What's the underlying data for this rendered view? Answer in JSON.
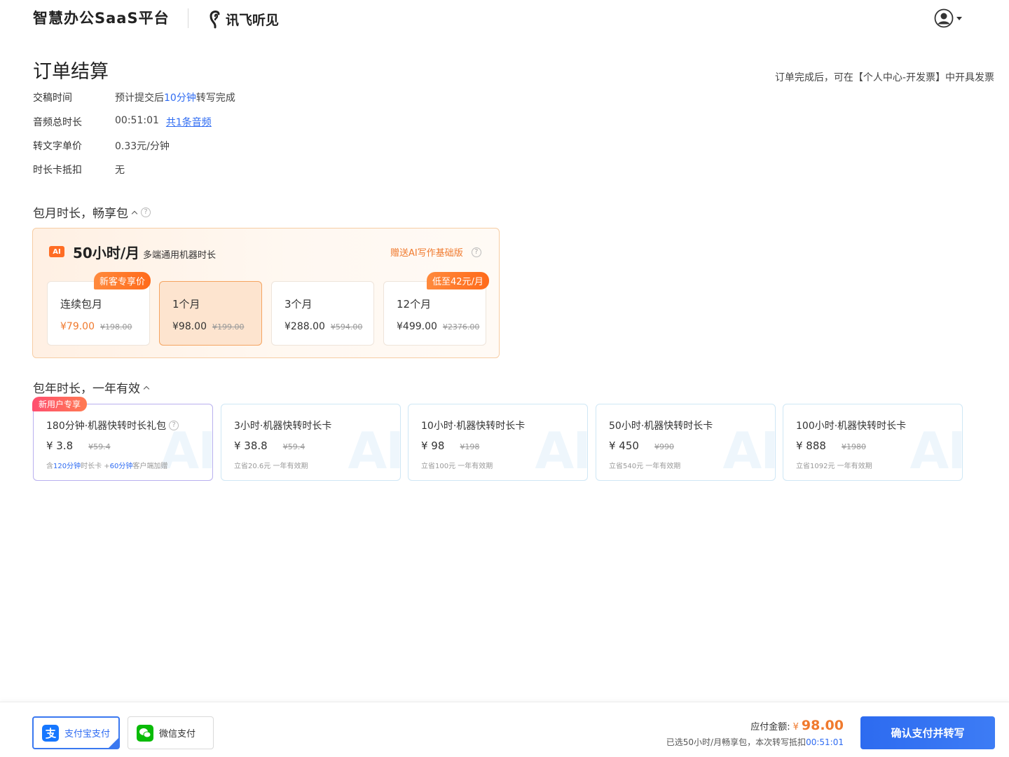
{
  "header": {
    "brand": "智慧办公SaaS平台",
    "partner_logo_text": "讯飞听见",
    "user_icon": "user-circle-icon"
  },
  "title": "订单结算",
  "invoice_note": "订单完成后，可在【个人中心-开发票】中开具发票",
  "info": {
    "delivery": {
      "label": "交稿时间",
      "pre": "预计提交后",
      "highlight": "10分钟",
      "post": "转写完成"
    },
    "duration": {
      "label": "音频总时长",
      "value": "00:51:01",
      "link": "共1条音频"
    },
    "price": {
      "label": "转文字单价",
      "value": "0.33元/分钟"
    },
    "deduct": {
      "label": "时长卡抵扣",
      "value": "无"
    }
  },
  "monthly": {
    "section_title": "包月时长，畅享包",
    "badge": "AI",
    "plan_title": "50小时/月",
    "plan_sub": "多端通用机器时长",
    "gift": "赠送AI写作基础版",
    "options": [
      {
        "name": "连续包月",
        "price": "¥79.00",
        "old": "¥198.00",
        "tag": "新客专享价"
      },
      {
        "name": "1个月",
        "price": "¥98.00",
        "old": "¥199.00"
      },
      {
        "name": "3个月",
        "price": "¥288.00",
        "old": "¥594.00"
      },
      {
        "name": "12个月",
        "price": "¥499.00",
        "old": "¥2376.00",
        "tag": "低至42元/月"
      }
    ]
  },
  "yearly": {
    "section_title": "包年时长，一年有效",
    "new_user_tag": "新用户专享",
    "watermark": "AI",
    "cards": [
      {
        "name": "180分钟·机器快转时长礼包",
        "price": "¥ 3.8",
        "old": "¥59.4",
        "desc_pre": "含",
        "desc_h1": "120分钟",
        "desc_mid": "时长卡 +",
        "desc_h2": "60分钟",
        "desc_post": "客户端加赠"
      },
      {
        "name": "3小时·机器快转时长卡",
        "price": "¥ 38.8",
        "old": "¥59.4",
        "desc": "立省20.6元 一年有效期"
      },
      {
        "name": "10小时·机器快转时长卡",
        "price": "¥ 98",
        "old": "¥198",
        "desc": "立省100元 一年有效期"
      },
      {
        "name": "50小时·机器快转时长卡",
        "price": "¥ 450",
        "old": "¥990",
        "desc": "立省540元 一年有效期"
      },
      {
        "name": "100小时·机器快转时长卡",
        "price": "¥ 888",
        "old": "¥1980",
        "desc": "立省1092元 一年有效期"
      }
    ]
  },
  "footer": {
    "alipay": "支付宝支付",
    "wechat": "微信支付",
    "total_label": "应付金额:",
    "total_currency": "¥",
    "total_amount": "98.00",
    "note_pre": "已选50小时/月畅享包，本次转写抵扣",
    "note_time": "00:51:01",
    "confirm": "确认支付并转写"
  },
  "colors": {
    "accent": "#2e6bf2",
    "orange": "#f07a2e",
    "tag_orange": "#ff6a1a",
    "tag_pink": "#ff4e6f"
  }
}
